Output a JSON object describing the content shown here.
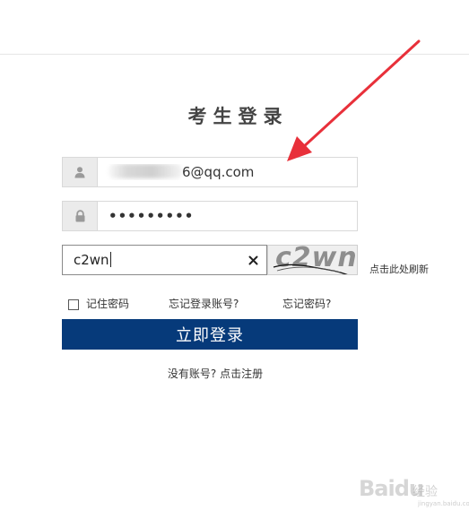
{
  "page": {
    "title": "考生登录"
  },
  "email": {
    "visible_suffix": "6@qq.com",
    "icon": "user-icon"
  },
  "password": {
    "masked_value": "•••••••••",
    "icon": "lock-icon"
  },
  "captcha": {
    "input_value": "c2wn",
    "image_text": "c2wn",
    "refresh_label": "点击此处刷新",
    "clear_icon": "close-icon"
  },
  "options": {
    "remember_label": "记住密码",
    "remember_checked": false,
    "forgot_account_label": "忘记登录账号?",
    "forgot_password_label": "忘记密码?"
  },
  "login_button": {
    "label": "立即登录"
  },
  "register": {
    "label": "没有账号? 点击注册"
  },
  "watermark": {
    "brand": "Baidu",
    "sub": "经验",
    "url": "jingyan.baidu.com"
  },
  "colors": {
    "primary": "#063a7a",
    "annotation_arrow": "#e8303a"
  }
}
